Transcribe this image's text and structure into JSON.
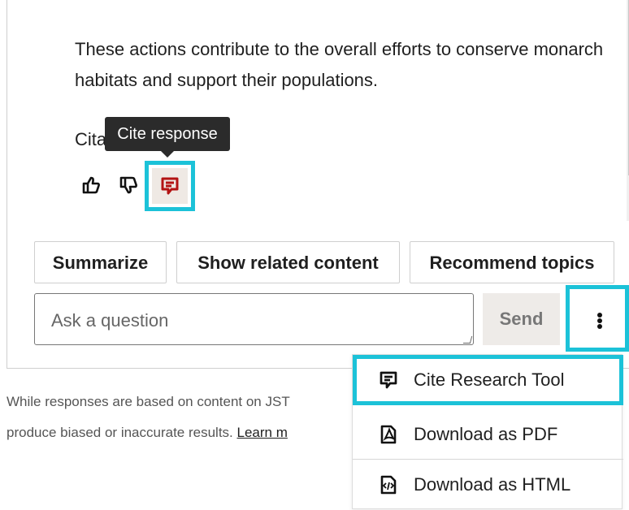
{
  "response": {
    "message": "These actions contribute to the overall efforts to conserve monarch habitats and support their populations.",
    "citation_prefix": "Cita",
    "tooltip": "Cite response"
  },
  "suggestions": [
    "Summarize",
    "Show related content",
    "Recommend topics"
  ],
  "composer": {
    "placeholder": "Ask a question",
    "send_label": "Send"
  },
  "disclaimer": {
    "text": "While responses are based on content on JST",
    "text_2": "produce biased or inaccurate results. ",
    "learn_more": "Learn m"
  },
  "menu": [
    "Cite Research Tool",
    "Download as PDF",
    "Download as HTML"
  ],
  "icons": [
    "thumbs-up-icon",
    "thumbs-down-icon",
    "cite-response-icon",
    "more-vertical-icon",
    "cite-icon",
    "pdf-icon",
    "html-icon"
  ],
  "colors": {
    "highlight": "#1cc2d8",
    "cite_icon": "#b31313",
    "send_background": "#eeebe8",
    "tooltip_background": "#2b2b2b"
  }
}
